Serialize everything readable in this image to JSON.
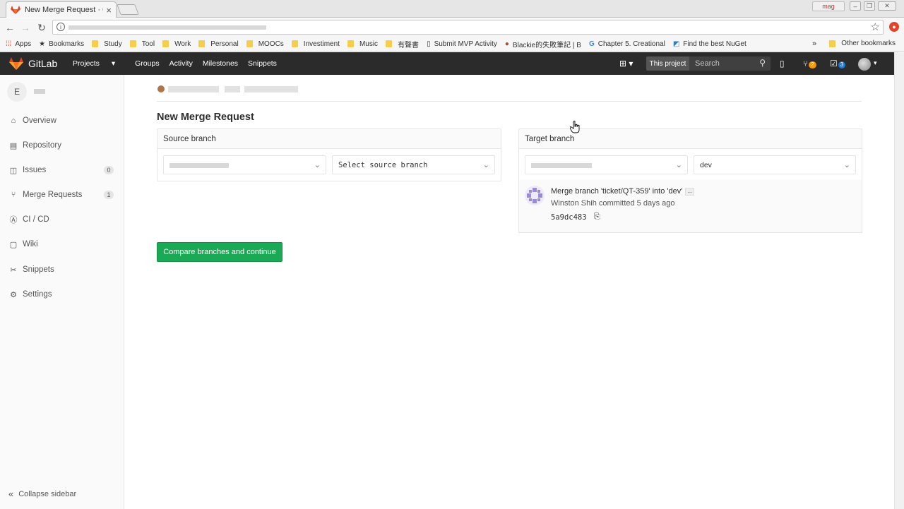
{
  "browser": {
    "tab_title": "New Merge Request · CA",
    "tab_close": "×",
    "profile_label": "mag",
    "bookmarks": [
      {
        "label": "Apps",
        "icon": "apps-grid-icon"
      },
      {
        "label": "Bookmarks",
        "icon": "star-icon"
      },
      {
        "label": "Study",
        "icon": "folder-icon"
      },
      {
        "label": "Tool",
        "icon": "folder-icon"
      },
      {
        "label": "Work",
        "icon": "folder-icon"
      },
      {
        "label": "Personal",
        "icon": "folder-icon"
      },
      {
        "label": "MOOCs",
        "icon": "folder-icon"
      },
      {
        "label": "Investiment",
        "icon": "folder-icon"
      },
      {
        "label": "Music",
        "icon": "folder-icon"
      },
      {
        "label": "有聲書",
        "icon": "folder-icon"
      },
      {
        "label": "Submit MVP Activity",
        "icon": "page-icon"
      },
      {
        "label": "Blackie的失敗筆記 | B",
        "icon": "avatar-icon"
      },
      {
        "label": "Chapter 5. Creational",
        "icon": "google-icon"
      },
      {
        "label": "Find the best NuGet",
        "icon": "nuget-icon"
      }
    ],
    "more_bookmarks": "»",
    "other_bookmarks": "Other bookmarks"
  },
  "header": {
    "brand": "GitLab",
    "nav": [
      "Projects",
      "Groups",
      "Activity",
      "Milestones",
      "Snippets"
    ],
    "projects_caret": "▾",
    "search_scope": "This project",
    "search_placeholder": "Search",
    "merge_requests_count": "2",
    "todos_count": "3"
  },
  "sidebar": {
    "project_initial": "E",
    "items": [
      {
        "label": "Overview",
        "icon": "home-icon",
        "count": ""
      },
      {
        "label": "Repository",
        "icon": "doc-icon",
        "count": ""
      },
      {
        "label": "Issues",
        "icon": "issues-icon",
        "count": "0"
      },
      {
        "label": "Merge Requests",
        "icon": "merge-icon",
        "count": "1"
      },
      {
        "label": "CI / CD",
        "icon": "rocket-icon",
        "count": ""
      },
      {
        "label": "Wiki",
        "icon": "book-icon",
        "count": ""
      },
      {
        "label": "Snippets",
        "icon": "scissors-icon",
        "count": ""
      },
      {
        "label": "Settings",
        "icon": "gear-icon",
        "count": ""
      }
    ],
    "collapse_label": "Collapse sidebar"
  },
  "main": {
    "title": "New Merge Request",
    "source": {
      "heading": "Source branch",
      "branch_placeholder": "Select source branch"
    },
    "target": {
      "heading": "Target branch",
      "branch_value": "dev",
      "commit": {
        "title": "Merge branch 'ticket/QT-359' into 'dev'",
        "ellipsis": "...",
        "author": "Winston Shih",
        "meta_rest": "committed 5 days ago",
        "sha": "5a9dc483"
      }
    },
    "compare_button": "Compare branches and continue"
  },
  "colors": {
    "header_bg": "#2b2b2b",
    "primary_green": "#1aaa55",
    "badge_orange": "#fc9403",
    "badge_blue": "#1f78d1"
  }
}
